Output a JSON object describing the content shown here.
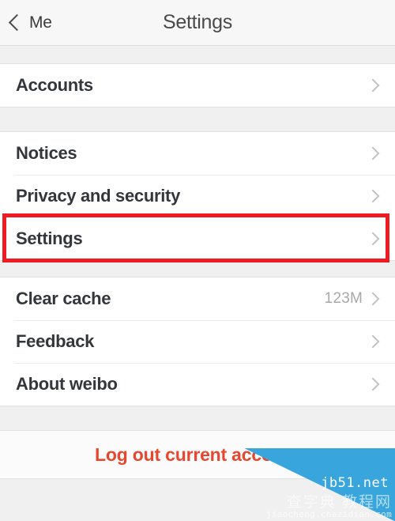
{
  "header": {
    "back_label": "Me",
    "back_icon": "chevron-left-icon",
    "title": "Settings"
  },
  "sections": [
    {
      "id": "accounts",
      "rows": [
        {
          "label": "Accounts",
          "value": "",
          "chevron": "chevron-right-icon"
        }
      ]
    },
    {
      "id": "general",
      "rows": [
        {
          "label": "Notices",
          "value": "",
          "chevron": "chevron-right-icon"
        },
        {
          "label": "Privacy and security",
          "value": "",
          "chevron": "chevron-right-icon"
        },
        {
          "label": "Settings",
          "value": "",
          "chevron": "chevron-right-icon"
        }
      ]
    },
    {
      "id": "support",
      "rows": [
        {
          "label": "Clear cache",
          "value": "123M",
          "chevron": "chevron-right-icon"
        },
        {
          "label": "Feedback",
          "value": "",
          "chevron": "chevron-right-icon"
        },
        {
          "label": "About weibo",
          "value": "",
          "chevron": "chevron-right-icon"
        }
      ]
    }
  ],
  "footer": {
    "logout_label": "Log out current account"
  },
  "annotation": {
    "target": "Settings",
    "color": "#ef1b23"
  },
  "watermark": {
    "site": "jb51.net",
    "cn_text": "查字典 教程网",
    "url": "jiaocheng.chazidian.com",
    "color": "#38a6dd"
  }
}
